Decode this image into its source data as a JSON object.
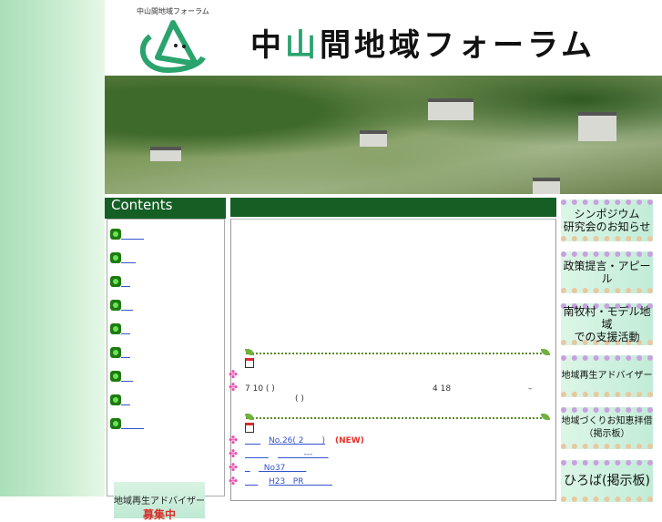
{
  "header": {
    "logo_text": "中山間地域フォーラム",
    "title_a": "中",
    "title_b": "山",
    "title_c": "間地域フォーラム"
  },
  "left": {
    "heading": "Contents",
    "links": [
      "        ",
      "     ",
      "   ",
      "    ",
      "   ",
      "   ",
      "    ",
      "   ",
      "        "
    ],
    "banner": {
      "line1": "地域再生アドバイザー",
      "line2": "募集中"
    }
  },
  "main": {
    "event": {
      "date": "7 10 ( )",
      "day": "4 18",
      "dash": "–",
      "paren": "( )"
    },
    "news": [
      {
        "pre": "      ",
        "label": "No.26( 2       )",
        "badge": "(NEW)"
      },
      {
        "pre": "         ",
        "label": "          ---      "
      },
      {
        "pre": "  ",
        "label": "  No37        "
      },
      {
        "pre": "     ",
        "label": "H23   PR           "
      }
    ]
  },
  "right": {
    "buttons": [
      "シンポジウム\n研究会のお知らせ",
      "政策提言・アピール",
      "南牧村・モデル地域\nでの支援活動",
      "地域再生アドバイザー",
      "地域づくりお知恵拝借\n（掲示板）",
      "ひろば(掲示板)"
    ]
  }
}
